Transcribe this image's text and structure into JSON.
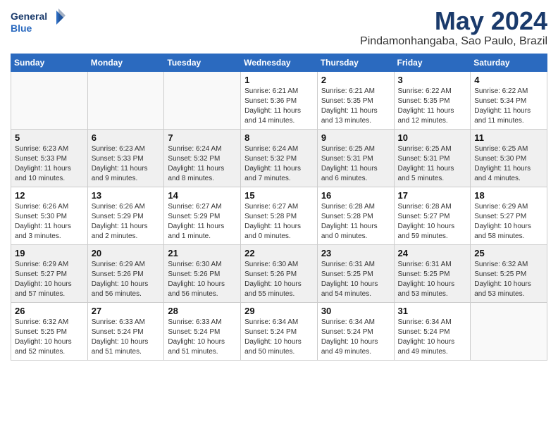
{
  "logo": {
    "line1": "General",
    "line2": "Blue"
  },
  "title": "May 2024",
  "subtitle": "Pindamonhangaba, Sao Paulo, Brazil",
  "days_of_week": [
    "Sunday",
    "Monday",
    "Tuesday",
    "Wednesday",
    "Thursday",
    "Friday",
    "Saturday"
  ],
  "weeks": [
    [
      {
        "day": "",
        "info": ""
      },
      {
        "day": "",
        "info": ""
      },
      {
        "day": "",
        "info": ""
      },
      {
        "day": "1",
        "info": "Sunrise: 6:21 AM\nSunset: 5:36 PM\nDaylight: 11 hours and 14 minutes."
      },
      {
        "day": "2",
        "info": "Sunrise: 6:21 AM\nSunset: 5:35 PM\nDaylight: 11 hours and 13 minutes."
      },
      {
        "day": "3",
        "info": "Sunrise: 6:22 AM\nSunset: 5:35 PM\nDaylight: 11 hours and 12 minutes."
      },
      {
        "day": "4",
        "info": "Sunrise: 6:22 AM\nSunset: 5:34 PM\nDaylight: 11 hours and 11 minutes."
      }
    ],
    [
      {
        "day": "5",
        "info": "Sunrise: 6:23 AM\nSunset: 5:33 PM\nDaylight: 11 hours and 10 minutes."
      },
      {
        "day": "6",
        "info": "Sunrise: 6:23 AM\nSunset: 5:33 PM\nDaylight: 11 hours and 9 minutes."
      },
      {
        "day": "7",
        "info": "Sunrise: 6:24 AM\nSunset: 5:32 PM\nDaylight: 11 hours and 8 minutes."
      },
      {
        "day": "8",
        "info": "Sunrise: 6:24 AM\nSunset: 5:32 PM\nDaylight: 11 hours and 7 minutes."
      },
      {
        "day": "9",
        "info": "Sunrise: 6:25 AM\nSunset: 5:31 PM\nDaylight: 11 hours and 6 minutes."
      },
      {
        "day": "10",
        "info": "Sunrise: 6:25 AM\nSunset: 5:31 PM\nDaylight: 11 hours and 5 minutes."
      },
      {
        "day": "11",
        "info": "Sunrise: 6:25 AM\nSunset: 5:30 PM\nDaylight: 11 hours and 4 minutes."
      }
    ],
    [
      {
        "day": "12",
        "info": "Sunrise: 6:26 AM\nSunset: 5:30 PM\nDaylight: 11 hours and 3 minutes."
      },
      {
        "day": "13",
        "info": "Sunrise: 6:26 AM\nSunset: 5:29 PM\nDaylight: 11 hours and 2 minutes."
      },
      {
        "day": "14",
        "info": "Sunrise: 6:27 AM\nSunset: 5:29 PM\nDaylight: 11 hours and 1 minute."
      },
      {
        "day": "15",
        "info": "Sunrise: 6:27 AM\nSunset: 5:28 PM\nDaylight: 11 hours and 0 minutes."
      },
      {
        "day": "16",
        "info": "Sunrise: 6:28 AM\nSunset: 5:28 PM\nDaylight: 11 hours and 0 minutes."
      },
      {
        "day": "17",
        "info": "Sunrise: 6:28 AM\nSunset: 5:27 PM\nDaylight: 10 hours and 59 minutes."
      },
      {
        "day": "18",
        "info": "Sunrise: 6:29 AM\nSunset: 5:27 PM\nDaylight: 10 hours and 58 minutes."
      }
    ],
    [
      {
        "day": "19",
        "info": "Sunrise: 6:29 AM\nSunset: 5:27 PM\nDaylight: 10 hours and 57 minutes."
      },
      {
        "day": "20",
        "info": "Sunrise: 6:29 AM\nSunset: 5:26 PM\nDaylight: 10 hours and 56 minutes."
      },
      {
        "day": "21",
        "info": "Sunrise: 6:30 AM\nSunset: 5:26 PM\nDaylight: 10 hours and 56 minutes."
      },
      {
        "day": "22",
        "info": "Sunrise: 6:30 AM\nSunset: 5:26 PM\nDaylight: 10 hours and 55 minutes."
      },
      {
        "day": "23",
        "info": "Sunrise: 6:31 AM\nSunset: 5:25 PM\nDaylight: 10 hours and 54 minutes."
      },
      {
        "day": "24",
        "info": "Sunrise: 6:31 AM\nSunset: 5:25 PM\nDaylight: 10 hours and 53 minutes."
      },
      {
        "day": "25",
        "info": "Sunrise: 6:32 AM\nSunset: 5:25 PM\nDaylight: 10 hours and 53 minutes."
      }
    ],
    [
      {
        "day": "26",
        "info": "Sunrise: 6:32 AM\nSunset: 5:25 PM\nDaylight: 10 hours and 52 minutes."
      },
      {
        "day": "27",
        "info": "Sunrise: 6:33 AM\nSunset: 5:24 PM\nDaylight: 10 hours and 51 minutes."
      },
      {
        "day": "28",
        "info": "Sunrise: 6:33 AM\nSunset: 5:24 PM\nDaylight: 10 hours and 51 minutes."
      },
      {
        "day": "29",
        "info": "Sunrise: 6:34 AM\nSunset: 5:24 PM\nDaylight: 10 hours and 50 minutes."
      },
      {
        "day": "30",
        "info": "Sunrise: 6:34 AM\nSunset: 5:24 PM\nDaylight: 10 hours and 49 minutes."
      },
      {
        "day": "31",
        "info": "Sunrise: 6:34 AM\nSunset: 5:24 PM\nDaylight: 10 hours and 49 minutes."
      },
      {
        "day": "",
        "info": ""
      }
    ]
  ]
}
